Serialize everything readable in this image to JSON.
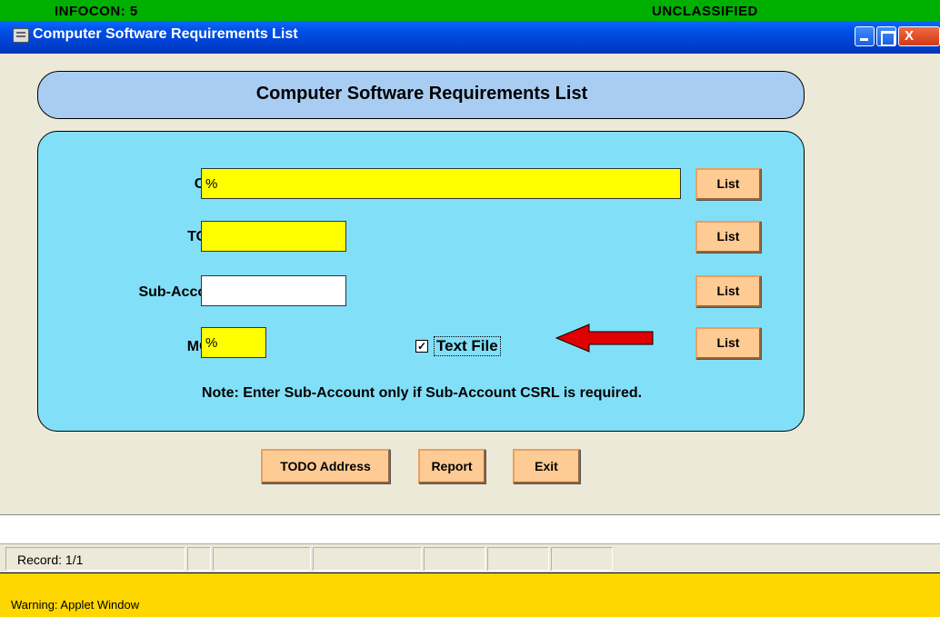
{
  "banner": {
    "infocon": "INFOCON: 5",
    "classification": "UNCLASSIFIED"
  },
  "window": {
    "title": "Computer Software Requirements List",
    "close_glyph": "X"
  },
  "header": {
    "title": "Computer Software Requirements List"
  },
  "form": {
    "fields": [
      {
        "label": "CPIN",
        "value": "%",
        "button": "List"
      },
      {
        "label": "TODO",
        "value": "",
        "button": "List"
      },
      {
        "label": "Sub-Account",
        "value": "",
        "button": "List"
      },
      {
        "label": "MCTR",
        "value": "%",
        "button": "List"
      }
    ],
    "text_file_label": "Text File",
    "text_file_checked": true,
    "note": "Note: Enter Sub-Account only if Sub-Account CSRL is required."
  },
  "actions": {
    "todo_address": "TODO Address",
    "report": "Report",
    "exit": "Exit"
  },
  "status": {
    "record": "Record: 1/1"
  },
  "warning": {
    "text": "Warning: Applet Window"
  },
  "colors": {
    "banner": "#00b000",
    "required_field": "#ffff00",
    "panel": "#82dff8",
    "header_pill": "#a9cdf2",
    "button": "#ffcb94",
    "arrow": "#e00000",
    "warning": "#ffd700"
  }
}
